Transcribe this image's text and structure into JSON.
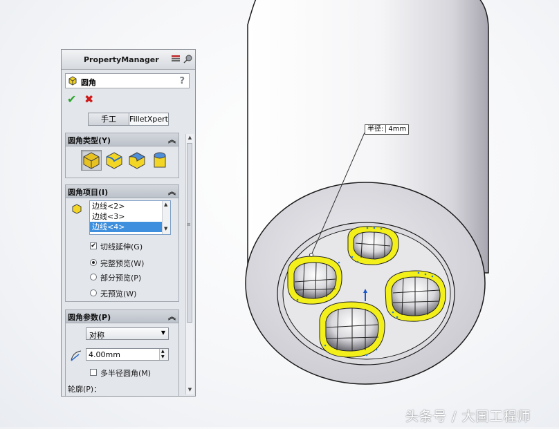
{
  "property_manager": {
    "title": "PropertyManager",
    "feature_name": "圆角",
    "help_icon": "?",
    "tabs": {
      "manual": "手工",
      "filletxpert": "FilletXpert"
    },
    "fillet_type_group": {
      "title": "圆角类型(Y)"
    },
    "fillet_items_group": {
      "title": "圆角项目(I)",
      "items": [
        "边线<2>",
        "边线<3>",
        "边线<4>"
      ],
      "selected_item": "边线<4>",
      "tangent_propagation": "切线延伸(G)",
      "tangent_checked": true,
      "preview_options": [
        "完整预览(W)",
        "部分预览(P)",
        "无预览(W)"
      ],
      "selected_preview": "完整预览(W)"
    },
    "fillet_params_group": {
      "title": "圆角参数(P)",
      "symmetry_select": "对称",
      "radius_value": "4.00mm",
      "multi_radius": "多半径圆角(M)",
      "multi_radius_checked": false,
      "profile_label": "轮廓(P)："
    }
  },
  "viewport": {
    "callout_label": "半径:",
    "callout_value": "4mm"
  },
  "watermark": "头条号 / 大国工程师",
  "colors": {
    "highlight_yellow": "#f2ef1a",
    "selection_blue": "#3e8fdd",
    "ok_green": "#2aa52a",
    "cancel_red": "#d01818"
  }
}
